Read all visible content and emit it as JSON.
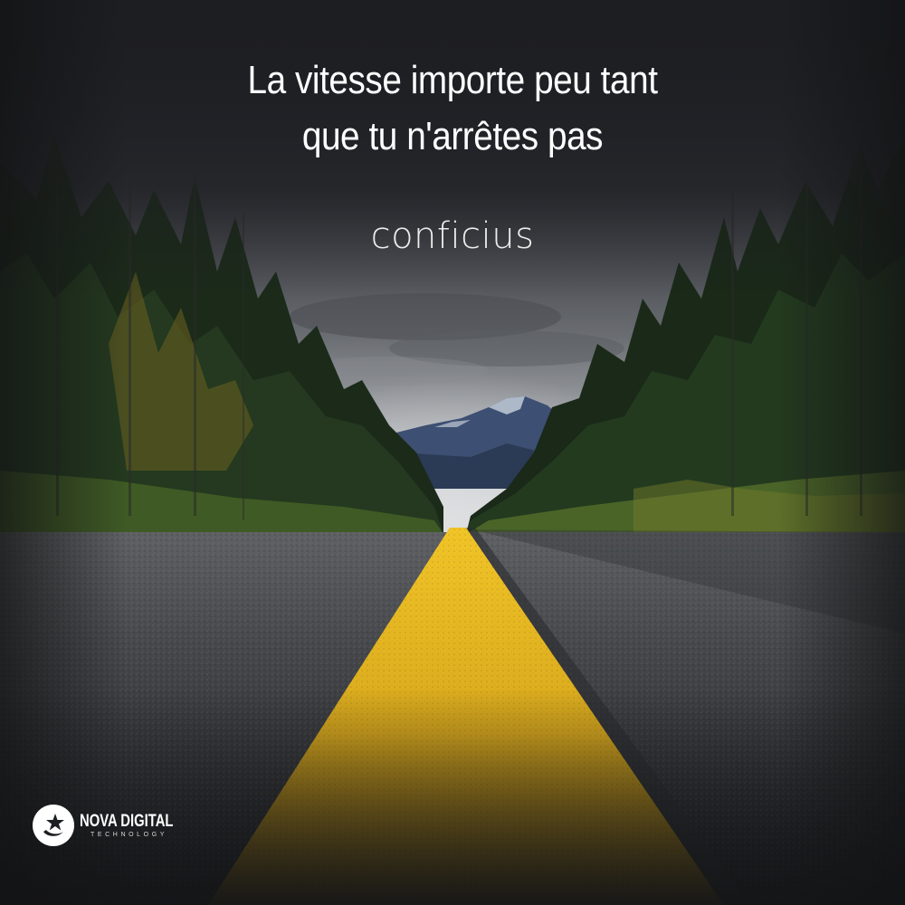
{
  "quote": {
    "lines": [
      "La vitesse importe peu tant",
      "que tu n'arrêtes pas"
    ]
  },
  "author": "conficius",
  "brand": {
    "name": "NOVA DIGITAL",
    "tagline": "TECHNOLOGY",
    "icon": "star-swoosh-icon"
  },
  "colors": {
    "background": "#1d1e22",
    "road_line": "#e3b21e",
    "asphalt": "#3c3e41",
    "forest": "#23361f",
    "text": "#ffffff"
  }
}
